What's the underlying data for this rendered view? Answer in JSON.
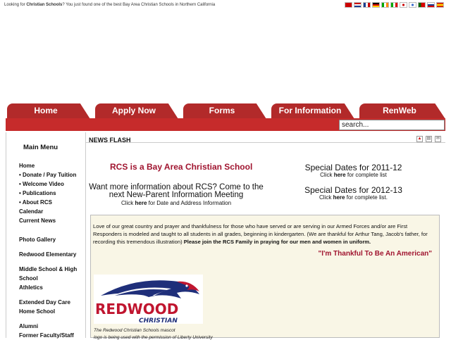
{
  "topline": {
    "prefix": "Looking for ",
    "bold": "Christian Schools",
    "suffix": "? You just found one of the best Bay Area Christian Schools in Northern California"
  },
  "tabs": [
    "Home",
    "Apply Now",
    "Forms",
    "For Information",
    "RenWeb"
  ],
  "search": {
    "value": "search..."
  },
  "sidebar": {
    "title": "Main Menu",
    "group1": [
      {
        "label": "Home",
        "level": 0
      },
      {
        "label": "Donate / Pay Tuition",
        "level": 1
      },
      {
        "label": "Welcome Video",
        "level": 1
      },
      {
        "label": "Publications",
        "level": 1
      },
      {
        "label": "About RCS",
        "level": 1
      },
      {
        "label": "Calendar",
        "level": 0
      },
      {
        "label": "Current News",
        "level": 0
      }
    ],
    "group2": [
      {
        "label": "Photo Gallery"
      },
      {
        "label": "Redwood Elementary"
      },
      {
        "label": "Middle School & High School"
      },
      {
        "label": "Athletics"
      },
      {
        "label": "Extended Day Care"
      },
      {
        "label": "Home School"
      },
      {
        "label": "Alumni"
      },
      {
        "label": "Former Faculty/Staff"
      }
    ]
  },
  "main": {
    "news_title": "NEWS FLASH",
    "rcs_title": "RCS is a Bay Area Christian School",
    "want_text": "Want more information about RCS? Come to the next New-Parent Information Meeting",
    "want_click": "Click ",
    "want_here": "here",
    "want_rest": " for Date and Address Information",
    "dates": [
      {
        "title": "Special Dates for 2011-12",
        "click": "Click ",
        "here": "here",
        "rest": " for complete list"
      },
      {
        "title": "Special Dates for 2012-13",
        "click": "Click ",
        "here": "here",
        "rest": " for complete list."
      }
    ],
    "para": "Love of our great country and prayer and thankfulness for those who have served or are serving in our Armed Forces and/or are First Responders is modeled and taught to all students in all grades, beginning in kindergarten.  (We are thankful for Arthur Tang, Jacob's father, for recording this tremendous illustration) ",
    "para_bold": "Please join the RCS Family in praying for our men and women in uniform.",
    "thank": "\"I'm Thankful To Be An American\"",
    "logo_word1": "REDWOOD",
    "logo_word2": "CHRISTIAN",
    "caption": "The Redwood Christian Schools mascot",
    "caption2": "logo is being used with the permission of Liberty University"
  },
  "colors": {
    "accent": "#b22a2a",
    "title_red": "#a0142f",
    "box_bg": "#f9f6e6"
  }
}
